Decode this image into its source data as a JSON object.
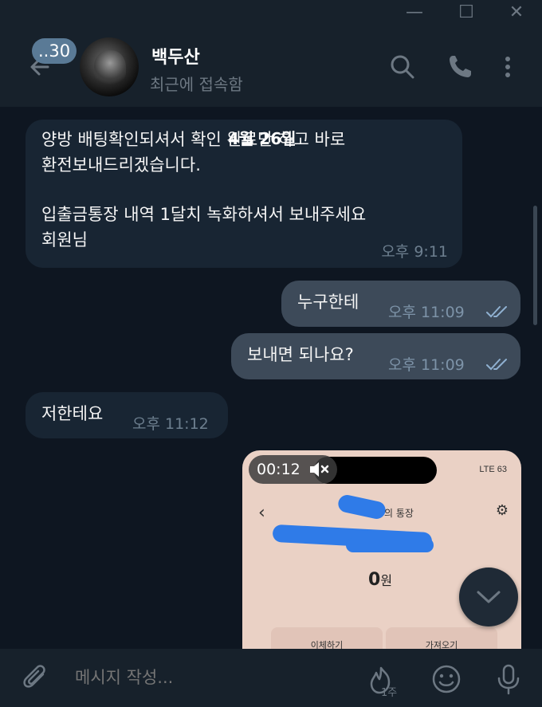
{
  "window": {
    "minimize": "—",
    "maximize": "☐",
    "close": "✕"
  },
  "header": {
    "unread_count": "..30",
    "contact_name": "백두산",
    "contact_status": "최근에 접속함"
  },
  "chat": {
    "date": "4월 26일",
    "messages": [
      {
        "direction": "in",
        "text_lines": [
          "양방 배팅확인되셔서 확인 완료만 하고 바로",
          "환전보내드리겠습니다.",
          "",
          "입출금통장 내역 1달치 녹화하셔서 보내주세요",
          "회원님"
        ],
        "time": "오후 9:11"
      },
      {
        "direction": "out",
        "text": "누구한테",
        "time": "오후 11:09",
        "read": true
      },
      {
        "direction": "out",
        "text": "보내면 되나요?",
        "time": "오후 11:09",
        "read": true
      },
      {
        "direction": "in",
        "text": "저한테요",
        "time": "오후 11:12"
      }
    ],
    "media": {
      "duration": "00:12",
      "phone_status": "LTE 63",
      "phone_title": "의 통장",
      "balance_value": "0",
      "balance_unit": "원",
      "button_left": "이체하기",
      "button_right": "가져오기"
    }
  },
  "composer": {
    "placeholder": "메시지 작성...",
    "timer_label": "1주"
  },
  "colors": {
    "background": "#0e1621",
    "panel": "#17212b",
    "incoming_bubble": "#182533",
    "outgoing_bubble": "#3d4a59",
    "badge": "#5a7a96"
  }
}
